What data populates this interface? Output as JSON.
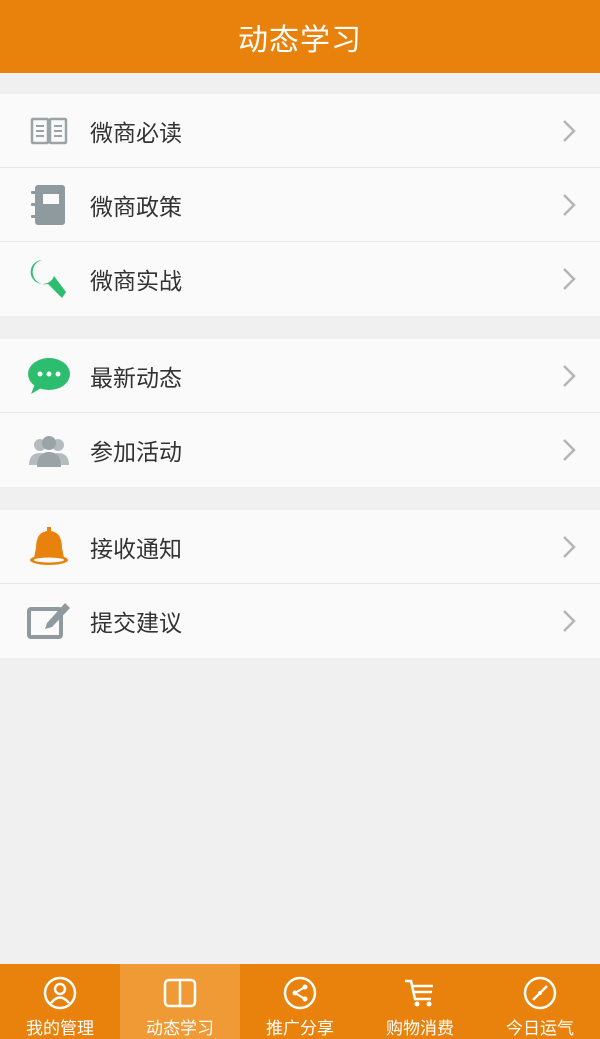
{
  "header": {
    "title": "动态学习"
  },
  "groups": [
    {
      "items": [
        {
          "label": "微商必读",
          "icon": "book-icon"
        },
        {
          "label": "微商政策",
          "icon": "notebook-icon"
        },
        {
          "label": "微商实战",
          "icon": "wrench-icon"
        }
      ]
    },
    {
      "items": [
        {
          "label": "最新动态",
          "icon": "chat-bubble-icon"
        },
        {
          "label": "参加活动",
          "icon": "people-icon"
        }
      ]
    },
    {
      "items": [
        {
          "label": "接收通知",
          "icon": "bell-icon"
        },
        {
          "label": "提交建议",
          "icon": "edit-icon"
        }
      ]
    }
  ],
  "tabs": [
    {
      "label": "我的管理",
      "icon": "user-icon",
      "active": false
    },
    {
      "label": "动态学习",
      "icon": "book-open-icon",
      "active": true
    },
    {
      "label": "推广分享",
      "icon": "share-icon",
      "active": false
    },
    {
      "label": "购物消费",
      "icon": "cart-icon",
      "active": false
    },
    {
      "label": "今日运气",
      "icon": "compass-icon",
      "active": false
    }
  ],
  "colors": {
    "accent": "#e8820c",
    "active_tab": "#f09a35",
    "green": "#2dbd6e",
    "gray_icon": "#9aa3a6"
  }
}
